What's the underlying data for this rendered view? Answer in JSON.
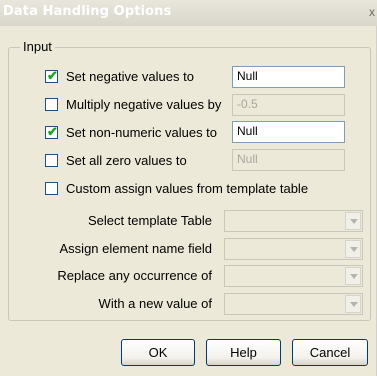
{
  "window": {
    "title": "Data Handling Options",
    "close_glyph": "x"
  },
  "group": {
    "label": "Input"
  },
  "checkbox_rows": [
    {
      "label": "Set negative values to",
      "checked": true,
      "value": "Null",
      "enabled": true
    },
    {
      "label": "Multiply negative values by",
      "checked": false,
      "value": "-0.5",
      "enabled": false
    },
    {
      "label": "Set non-numeric values to",
      "checked": true,
      "value": "Null",
      "enabled": true
    },
    {
      "label": "Set all zero values to",
      "checked": false,
      "value": "Null",
      "enabled": false
    },
    {
      "label": "Custom assign values from template table",
      "checked": false
    }
  ],
  "template_fields": [
    {
      "label": "Select template Table",
      "value": ""
    },
    {
      "label": "Assign element name field",
      "value": ""
    },
    {
      "label": "Replace any occurrence of",
      "value": ""
    },
    {
      "label": "With a new value of",
      "value": ""
    }
  ],
  "buttons": {
    "ok": "OK",
    "help": "Help",
    "cancel": "Cancel"
  },
  "icons": {
    "checkbox_mark": "✔",
    "dropdown_arrow": "chevron-down-icon"
  }
}
